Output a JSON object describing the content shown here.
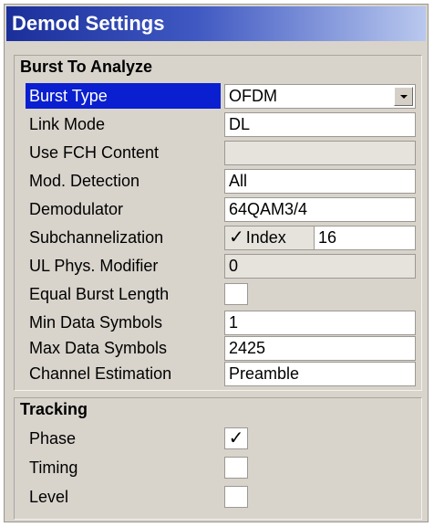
{
  "window": {
    "title": "Demod Settings"
  },
  "burst_group": {
    "title": "Burst To Analyze",
    "burst_type": {
      "label": "Burst Type",
      "value": "OFDM"
    },
    "link_mode": {
      "label": "Link Mode",
      "value": "DL"
    },
    "use_fch": {
      "label": "Use FCH Content",
      "value": ""
    },
    "mod_detection": {
      "label": "Mod. Detection",
      "value": "All"
    },
    "demodulator": {
      "label": "Demodulator",
      "value": "64QAM3/4"
    },
    "subchannelization": {
      "label": "Subchannelization",
      "check": "✓",
      "sub_label": "Index",
      "value": "16"
    },
    "ul_phys_modifier": {
      "label": "UL Phys. Modifier",
      "value": "0"
    },
    "equal_burst_length": {
      "label": "Equal Burst Length",
      "check": ""
    },
    "min_data_symbols": {
      "label": "Min Data Symbols",
      "value": "1"
    },
    "max_data_symbols": {
      "label": "Max Data Symbols",
      "value": "2425"
    },
    "channel_estimation": {
      "label": "Channel Estimation",
      "value": "Preamble"
    }
  },
  "tracking_group": {
    "title": "Tracking",
    "phase": {
      "label": "Phase",
      "check": "✓"
    },
    "timing": {
      "label": "Timing",
      "check": ""
    },
    "level": {
      "label": "Level",
      "check": ""
    }
  }
}
